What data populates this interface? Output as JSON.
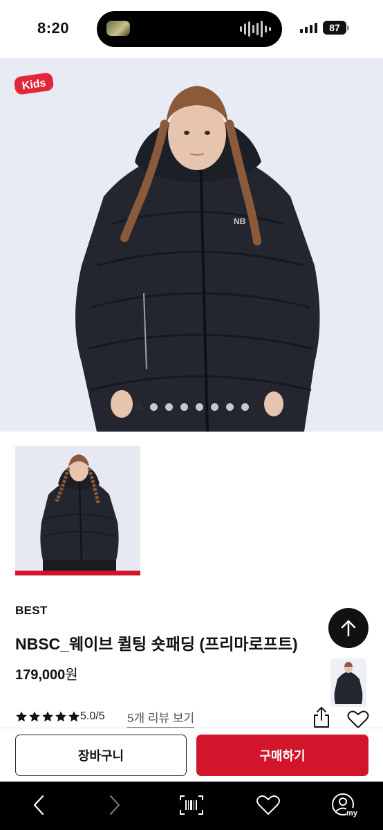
{
  "status_bar": {
    "time": "8:20",
    "battery": "87"
  },
  "hero": {
    "badge_text": "Kids",
    "slide_count": 8,
    "active_slide": 1
  },
  "product": {
    "badge": "BEST",
    "title": "NBSC_웨이브 퀼팅 숏패딩 (프리마로프트)",
    "price": "179,000",
    "price_unit": "원",
    "rating": "5.0/5",
    "stars": 5,
    "review_link": "5개 리뷰 보기"
  },
  "actions": {
    "cart_label": "장바구니",
    "buy_label": "구매하기"
  },
  "browser_nav": {
    "items": [
      "back-icon",
      "forward-icon",
      "barcode-icon",
      "heart-icon",
      "my-icon"
    ],
    "my_label": "my"
  },
  "colors": {
    "accent": "#d2152b",
    "text": "#111111",
    "jacket": "#23262e"
  }
}
